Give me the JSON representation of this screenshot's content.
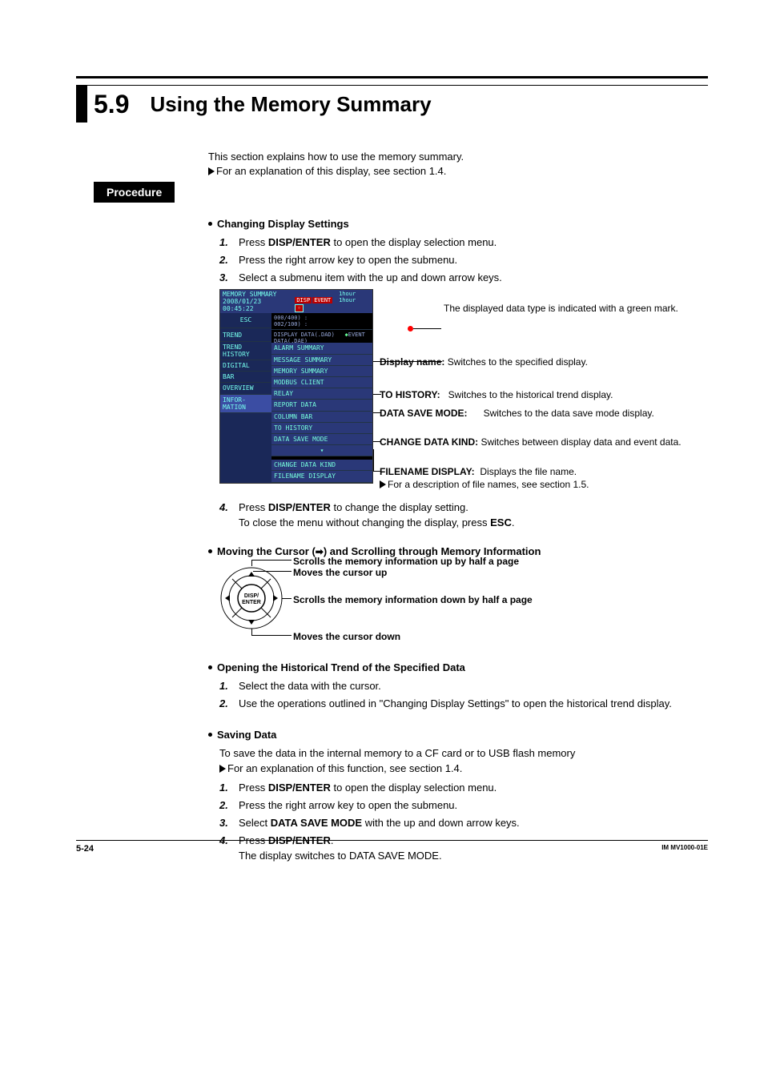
{
  "section": {
    "number": "5.9",
    "title": "Using the Memory Summary"
  },
  "intro": {
    "line1": "This section explains how to use the memory summary.",
    "line2": "For an explanation of this display, see section 1.4."
  },
  "procedure_label": "Procedure",
  "h1": "Changing Display Settings",
  "steps1": {
    "s1a": "Press ",
    "s1b": "DISP/ENTER",
    "s1c": " to open the display selection menu.",
    "s2": "Press the right arrow key to open the submenu.",
    "s3": "Select a submenu item with the up and down arrow keys.",
    "s4a": "Press ",
    "s4b": "DISP/ENTER",
    "s4c": " to change the display setting.",
    "s4d": "To close the menu without changing the display, press ",
    "s4e": "ESC",
    "s4f": "."
  },
  "screenshot": {
    "title1": "MEMORY SUMMARY",
    "title2": "2008/01/23 00:45:22",
    "badge1": "DISP",
    "badge2": "EVENT",
    "meter1": "000/400) :",
    "meter2": "002/100) :",
    "esc": "ESC",
    "top_black1": "DISPLAY DATA(.DAD)",
    "top_black2": "EVENT DATA(.DAE)",
    "left": [
      "TREND",
      "TREND HISTORY",
      "DIGITAL",
      "BAR",
      "OVERVIEW",
      "INFOR- MATION"
    ],
    "right": [
      "ALARM SUMMARY",
      "MESSAGE SUMMARY",
      "MEMORY SUMMARY",
      "MODBUS CLIENT",
      "RELAY",
      "REPORT DATA",
      "COLUMN BAR",
      "TO HISTORY",
      "DATA SAVE MODE",
      "▾",
      "CHANGE DATA KIND",
      "FILENAME DISPLAY"
    ]
  },
  "callouts": {
    "green": "The displayed data type is indicated with a green mark.",
    "disp_name_l": "Display name:",
    "disp_name_r": "Switches to the specified display.",
    "to_hist_l": "TO HISTORY:",
    "to_hist_r": "Switches to the historical trend display.",
    "save_l": "DATA SAVE MODE:",
    "save_r": "Switches to the data save mode display.",
    "kind_l": "CHANGE DATA KIND:",
    "kind_r": "Switches between display data and event data.",
    "fname_l": "FILENAME DISPLAY:",
    "fname_r": "Displays the file name.",
    "fname_note": "For a description of file names, see section 1.5."
  },
  "h2_pre": "Moving the Cursor (",
  "h2_post": ") and Scrolling through Memory Information",
  "arrow_labels": {
    "up_half": "Scrolls the memory information up by half a page",
    "up": "Moves the cursor up",
    "down_half": "Scrolls the memory information down by half a page",
    "down": "Moves the cursor down"
  },
  "h3": "Opening the Historical Trend of the Specified Data",
  "steps3": {
    "s1": "Select the data with the cursor.",
    "s2": "Use the operations outlined in \"Changing Display Settings\" to open the historical trend display."
  },
  "h4": "Saving Data",
  "save_intro1": "To save the data in the internal memory to a CF card or to USB flash memory",
  "save_intro2": "For an explanation of this function, see section 1.4.",
  "steps4": {
    "s1a": "Press ",
    "s1b": "DISP/ENTER",
    "s1c": " to open the display selection menu.",
    "s2": "Press the right arrow key to open the submenu.",
    "s3a": "Select ",
    "s3b": "DATA SAVE MODE",
    "s3c": " with the up and down arrow keys.",
    "s4a": "Press ",
    "s4b": "DISP/ENTER",
    "s4c": ".",
    "s4d": "The display switches to DATA SAVE MODE."
  },
  "footer": {
    "left": "5-24",
    "right": "IM MV1000-01E"
  }
}
